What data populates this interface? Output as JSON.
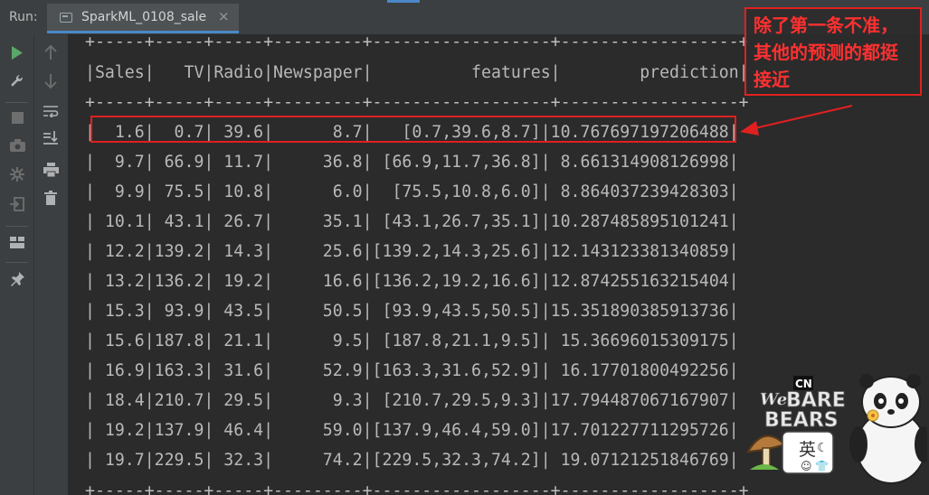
{
  "run_label": "Run:",
  "tab": {
    "label": "SparkML_0108_sale",
    "close": "×"
  },
  "left_toolbar": [
    {
      "name": "run-icon",
      "glyph": "▶",
      "color": "#59a869"
    },
    {
      "name": "wrench-icon",
      "glyph": "🔧",
      "color": "#afb1b3"
    },
    {
      "name": "stop-icon",
      "glyph": "■",
      "color": "#6e6e6e"
    },
    {
      "name": "camera-icon",
      "glyph": "📷",
      "color": "#6e6e6e"
    },
    {
      "name": "debug-icon",
      "glyph": "✹",
      "color": "#6e6e6e"
    },
    {
      "name": "exit-icon",
      "glyph": "⇥",
      "color": "#6e6e6e"
    },
    {
      "name": "layout-icon",
      "glyph": "▦",
      "color": "#afb1b3"
    },
    {
      "name": "pin-icon",
      "glyph": "📌",
      "color": "#afb1b3"
    }
  ],
  "console_toolbar": [
    {
      "name": "up-icon",
      "glyph": "↑",
      "color": "#6e6e6e"
    },
    {
      "name": "down-icon",
      "glyph": "↓",
      "color": "#6e6e6e"
    },
    {
      "name": "soft-wrap-icon",
      "glyph": "↵",
      "color": "#afb1b3"
    },
    {
      "name": "scroll-to-end-icon",
      "glyph": "⇊",
      "color": "#afb1b3"
    },
    {
      "name": "print-icon",
      "glyph": "⎙",
      "color": "#afb1b3"
    },
    {
      "name": "trash-icon",
      "glyph": "🗑",
      "color": "#afb1b3"
    }
  ],
  "table": {
    "border_line": "+-----+-----+-----+---------+------------------+------------------+",
    "header_line": "|Sales|   TV|Radio|Newspaper|          features|        prediction|",
    "rows": [
      "|  1.6|  0.7| 39.6|      8.7|   [0.7,39.6,8.7]|10.767697197206488|",
      "|  9.7| 66.9| 11.7|     36.8| [66.9,11.7,36.8]| 8.661314908126998|",
      "|  9.9| 75.5| 10.8|      6.0|  [75.5,10.8,6.0]| 8.864037239428303|",
      "| 10.1| 43.1| 26.7|     35.1| [43.1,26.7,35.1]|10.287485895101241|",
      "| 12.2|139.2| 14.3|     25.6|[139.2,14.3,25.6]|12.143123381340859|",
      "| 13.2|136.2| 19.2|     16.6|[136.2,19.2,16.6]|12.874255163215404|",
      "| 15.3| 93.9| 43.5|     50.5| [93.9,43.5,50.5]|15.351890385913736|",
      "| 15.6|187.8| 21.1|      9.5| [187.8,21.1,9.5]| 15.36696015309175|",
      "| 16.9|163.3| 31.6|     52.9|[163.3,31.6,52.9]| 16.17701800492256|",
      "| 18.4|210.7| 29.5|      9.3| [210.7,29.5,9.3]|17.794487067167907|",
      "| 19.2|137.9| 46.4|     59.0|[137.9,46.4,59.0]|17.701227711295726|",
      "| 19.7|229.5| 32.3|     74.2|[229.5,32.3,74.2]| 19.07121251846769|"
    ]
  },
  "annotation": {
    "line1": "除了第一条不准，",
    "line2": "其他的预测的都挺",
    "line3": "接近"
  },
  "sticker": {
    "cn": "CN",
    "we": "We",
    "bare": "BARE",
    "bears": "BEARS",
    "char": "英"
  },
  "colors": {
    "highlight": "#e02020",
    "annotation_text": "#ff3030",
    "tab_underline": "#4a88c7"
  }
}
